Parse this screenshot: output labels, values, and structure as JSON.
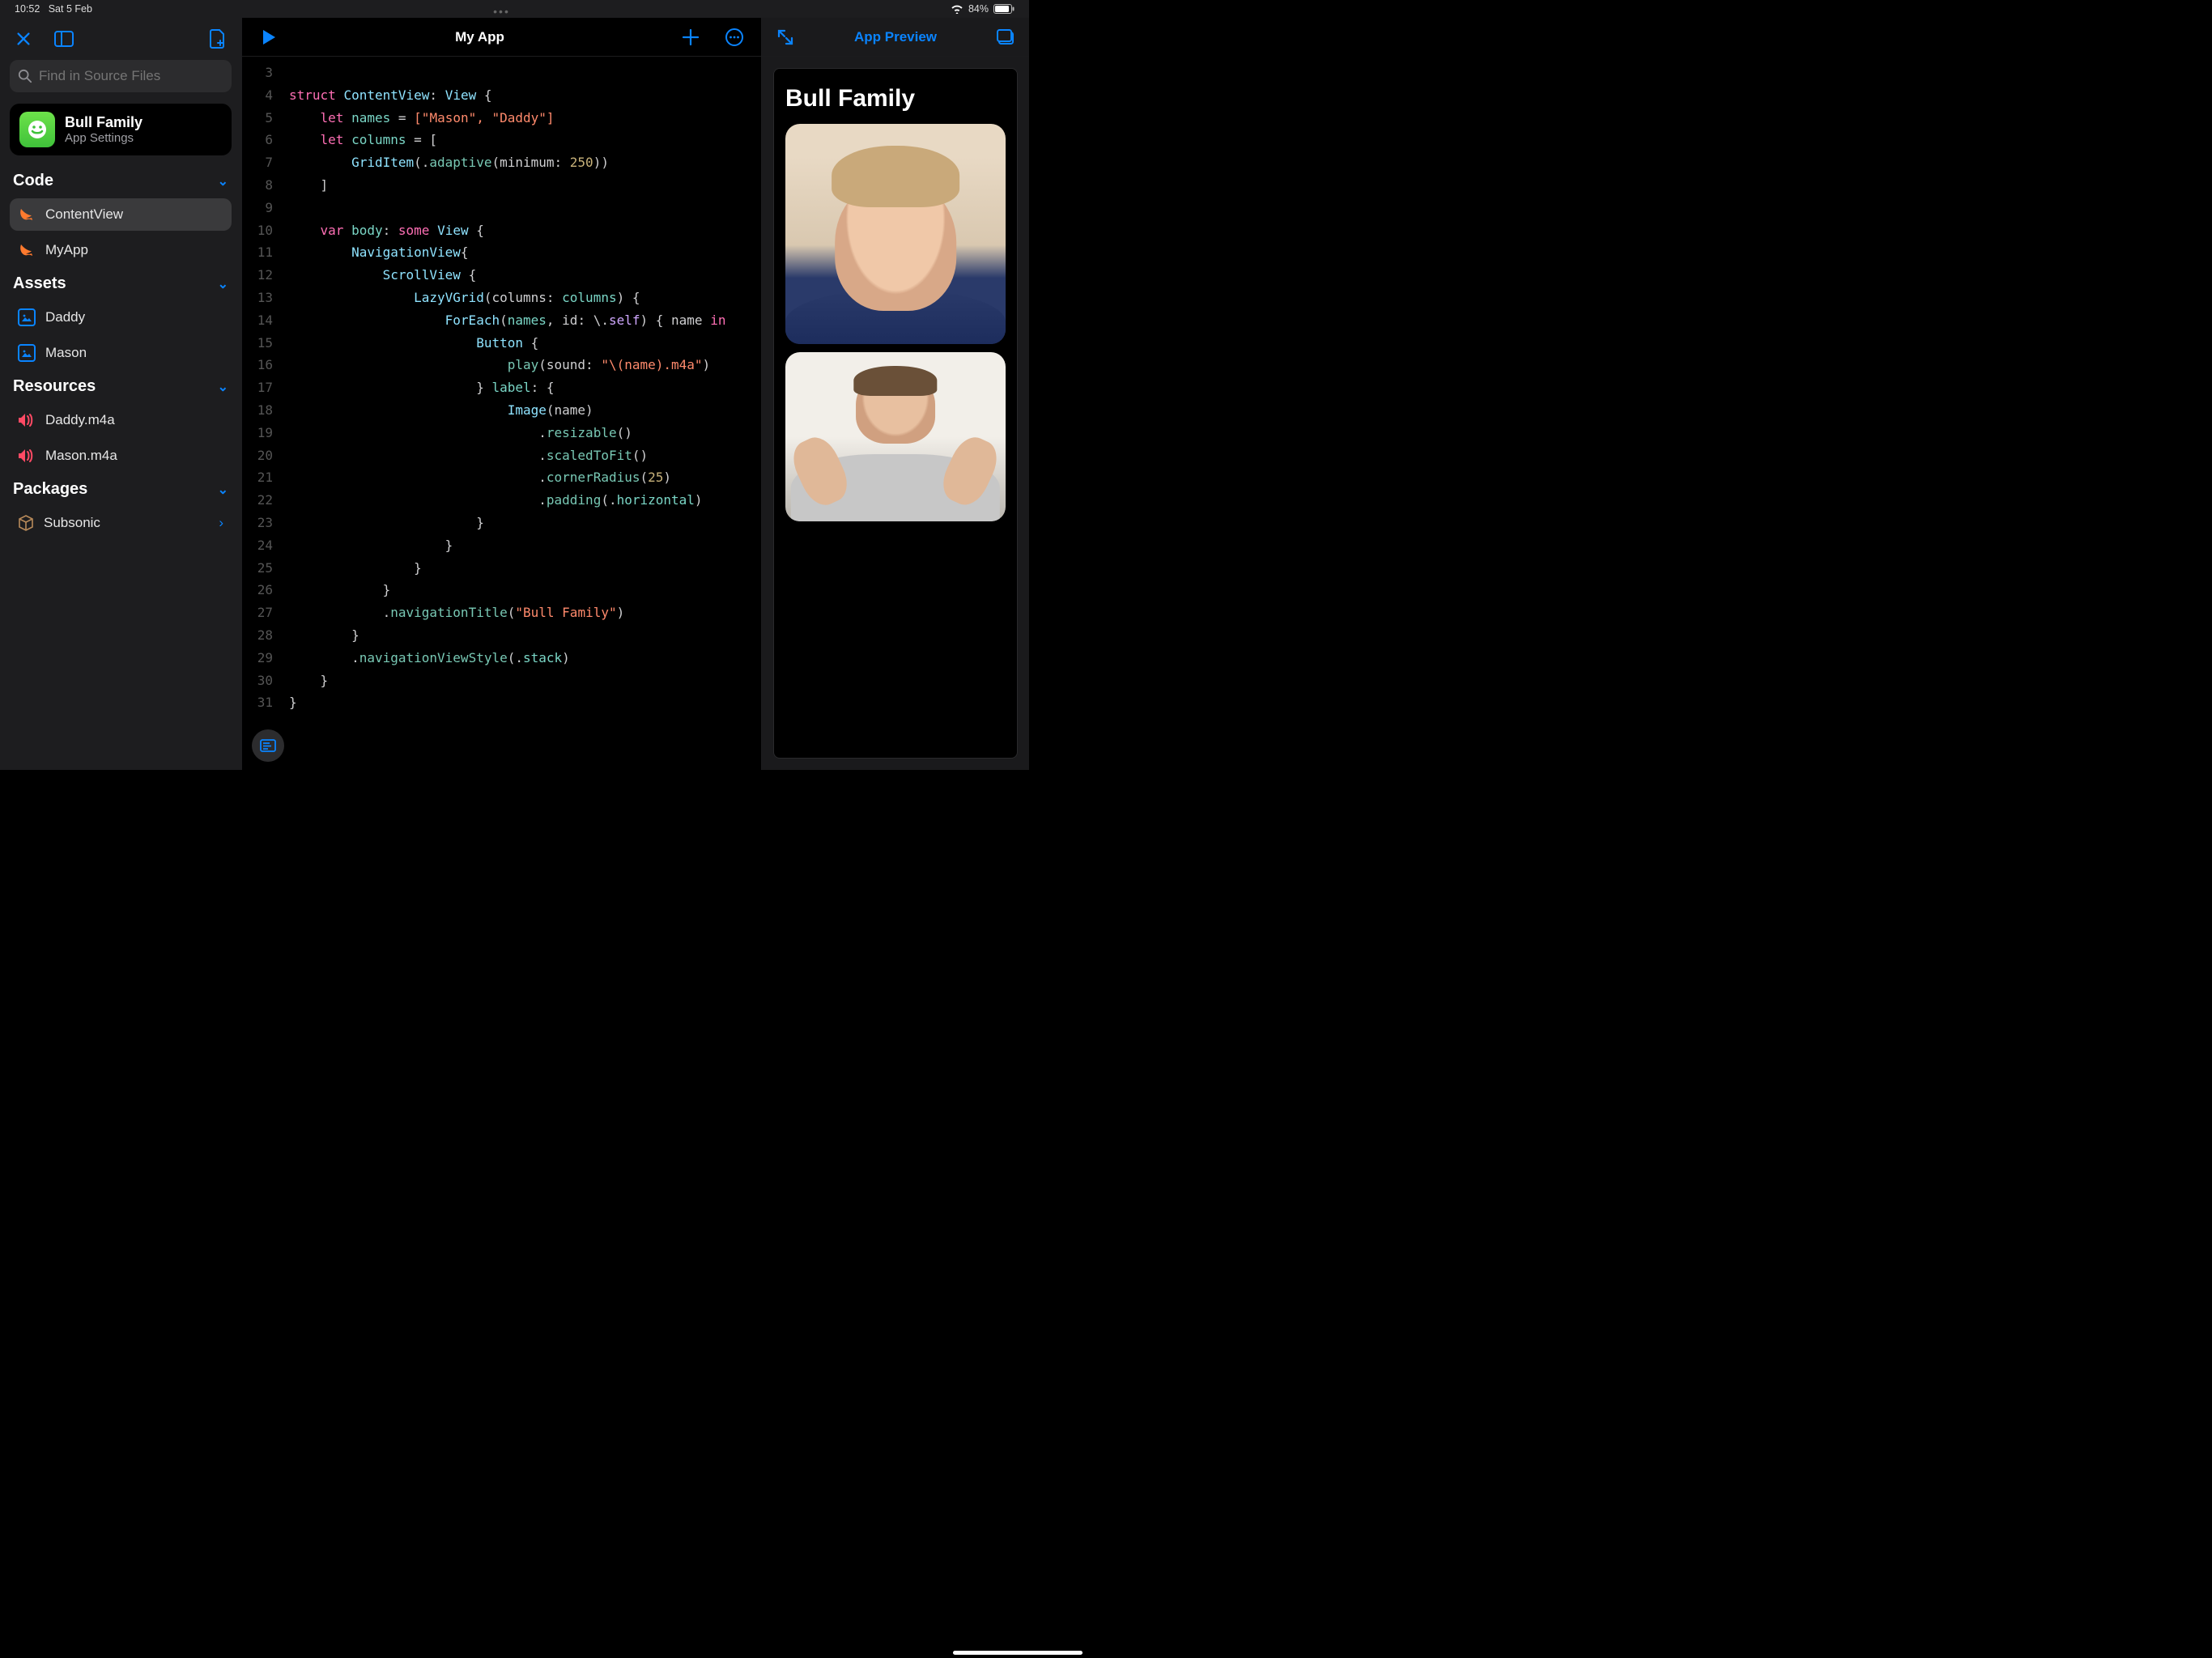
{
  "status": {
    "time": "10:52",
    "date": "Sat 5 Feb",
    "battery": "84%"
  },
  "sidebar": {
    "search_placeholder": "Find in Source Files",
    "app": {
      "name": "Bull Family",
      "subtitle": "App Settings"
    },
    "sections": {
      "code": {
        "title": "Code",
        "items": [
          "ContentView",
          "MyApp"
        ]
      },
      "assets": {
        "title": "Assets",
        "items": [
          "Daddy",
          "Mason"
        ]
      },
      "resources": {
        "title": "Resources",
        "items": [
          "Daddy.m4a",
          "Mason.m4a"
        ]
      },
      "packages": {
        "title": "Packages",
        "items": [
          "Subsonic"
        ]
      }
    }
  },
  "editor": {
    "title": "My App",
    "line_start": 3,
    "line_end": 31,
    "code": {
      "nav_title": "\"Bull Family\"",
      "names_arr": "[\"Mason\", \"Daddy\"]",
      "grid_min": "250",
      "sound_fmt": "\"\\(name).m4a\"",
      "corner_radius": "25"
    }
  },
  "preview": {
    "title": "App Preview",
    "nav_title": "Bull Family"
  }
}
